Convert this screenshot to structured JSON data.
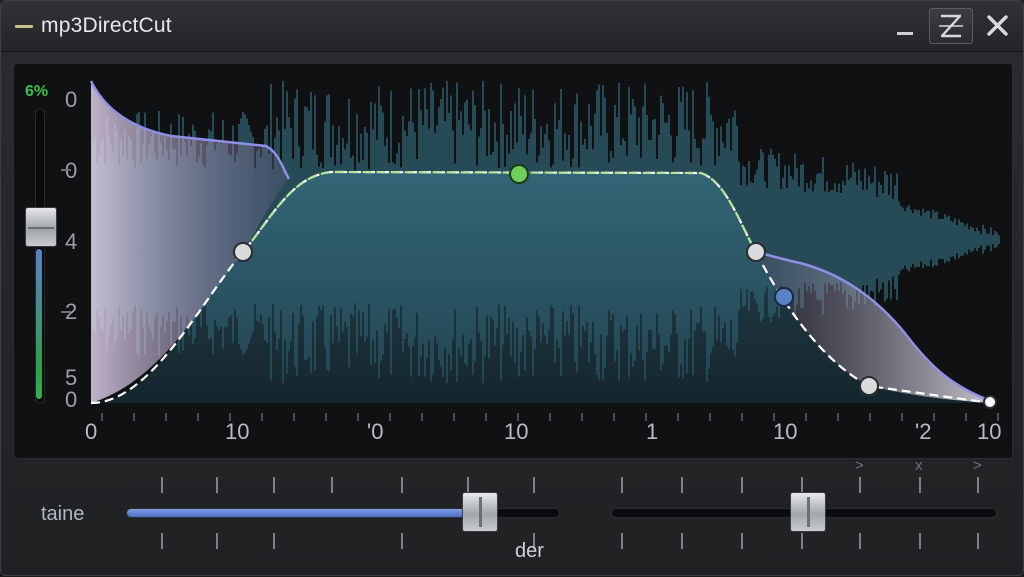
{
  "window": {
    "title": "mp3DirectCut"
  },
  "titlebar": {
    "minimize": "",
    "maximize": "Z",
    "close": "✕"
  },
  "gain_slider": {
    "percent": "6%",
    "level": 0.5,
    "accent": "#3fbf4f"
  },
  "scale_labels": [
    "0",
    "0",
    "4",
    "2",
    "5",
    "0"
  ],
  "x_axis_labels": [
    "0",
    "10",
    "'0",
    "10",
    "1",
    "10",
    "'2",
    "10"
  ],
  "controls": {
    "left_label": "taine",
    "left_value_label": "der",
    "left_fill": 0.78,
    "right_fill": 0.51,
    "top_glyphs": [
      ">",
      "x",
      ">"
    ]
  },
  "colors": {
    "waveform": "#3d7f93",
    "envelope": "#b7e39a",
    "fade_curve": "#8f8fe6",
    "node_active": "#6fcf5a",
    "node_blue": "#5a82c7"
  },
  "icons": [
    "minimize-icon",
    "maximize-icon",
    "close-icon"
  ]
}
